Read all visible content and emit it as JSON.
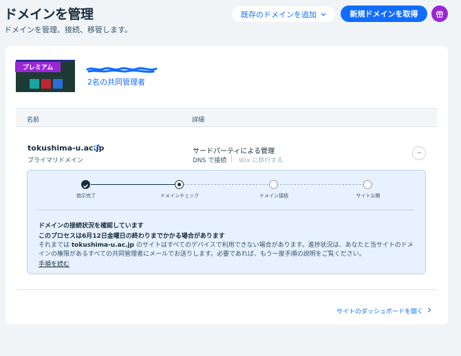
{
  "header": {
    "title": "ドメインを管理",
    "subtitle": "ドメインを管理、接続、移管します。",
    "existing_domain_button": "既存のドメインを追加",
    "new_domain_button": "新規ドメインを取得"
  },
  "site": {
    "badge": "プレミアム",
    "collaborators_link": "2名の共同管理者"
  },
  "table": {
    "columns": [
      "名前",
      "詳細"
    ]
  },
  "domain": {
    "name": "tokushima-u.ac.jp",
    "type": "プライマリドメイン",
    "management": "サードパーティによる管理",
    "connection": "DNS で接続",
    "move_link": "Wix に移行する"
  },
  "steps": [
    {
      "label": "指示完了",
      "state": "done"
    },
    {
      "label": "ドメインチェック",
      "state": "current"
    },
    {
      "label": "ドメイン接続",
      "state": "pending"
    },
    {
      "label": "サイト公開",
      "state": "pending"
    }
  ],
  "status_message": {
    "title": "ドメインの接続状況を確認しています",
    "subtitle": "このプロセスは6月12日金曜日の終わりまでかかる場合があります",
    "body_prefix": "それまでは ",
    "body_domain": "tokushima-u.ac.jp",
    "body_rest": " のサイトはすべてのデバイスで利用できない場合があります。進捗状況は、あなたと当サイトのドメインの権限があるすべての共同管理者にメールでお送りします。必要であれば、もう一度手順の説明をご覧ください。",
    "link": "手順を読む"
  },
  "footer": {
    "dashboard_link": "サイトのダッシュボードを開く"
  },
  "colors": {
    "accent": "#116dff",
    "premium": "#9a27d5",
    "panel_bg": "#e8f1ff",
    "step_done": "#162d3d"
  },
  "icons": [
    "chevron-down-icon",
    "gift-icon",
    "external-link-icon",
    "more-icon",
    "check-icon",
    "chevron-right-icon"
  ]
}
